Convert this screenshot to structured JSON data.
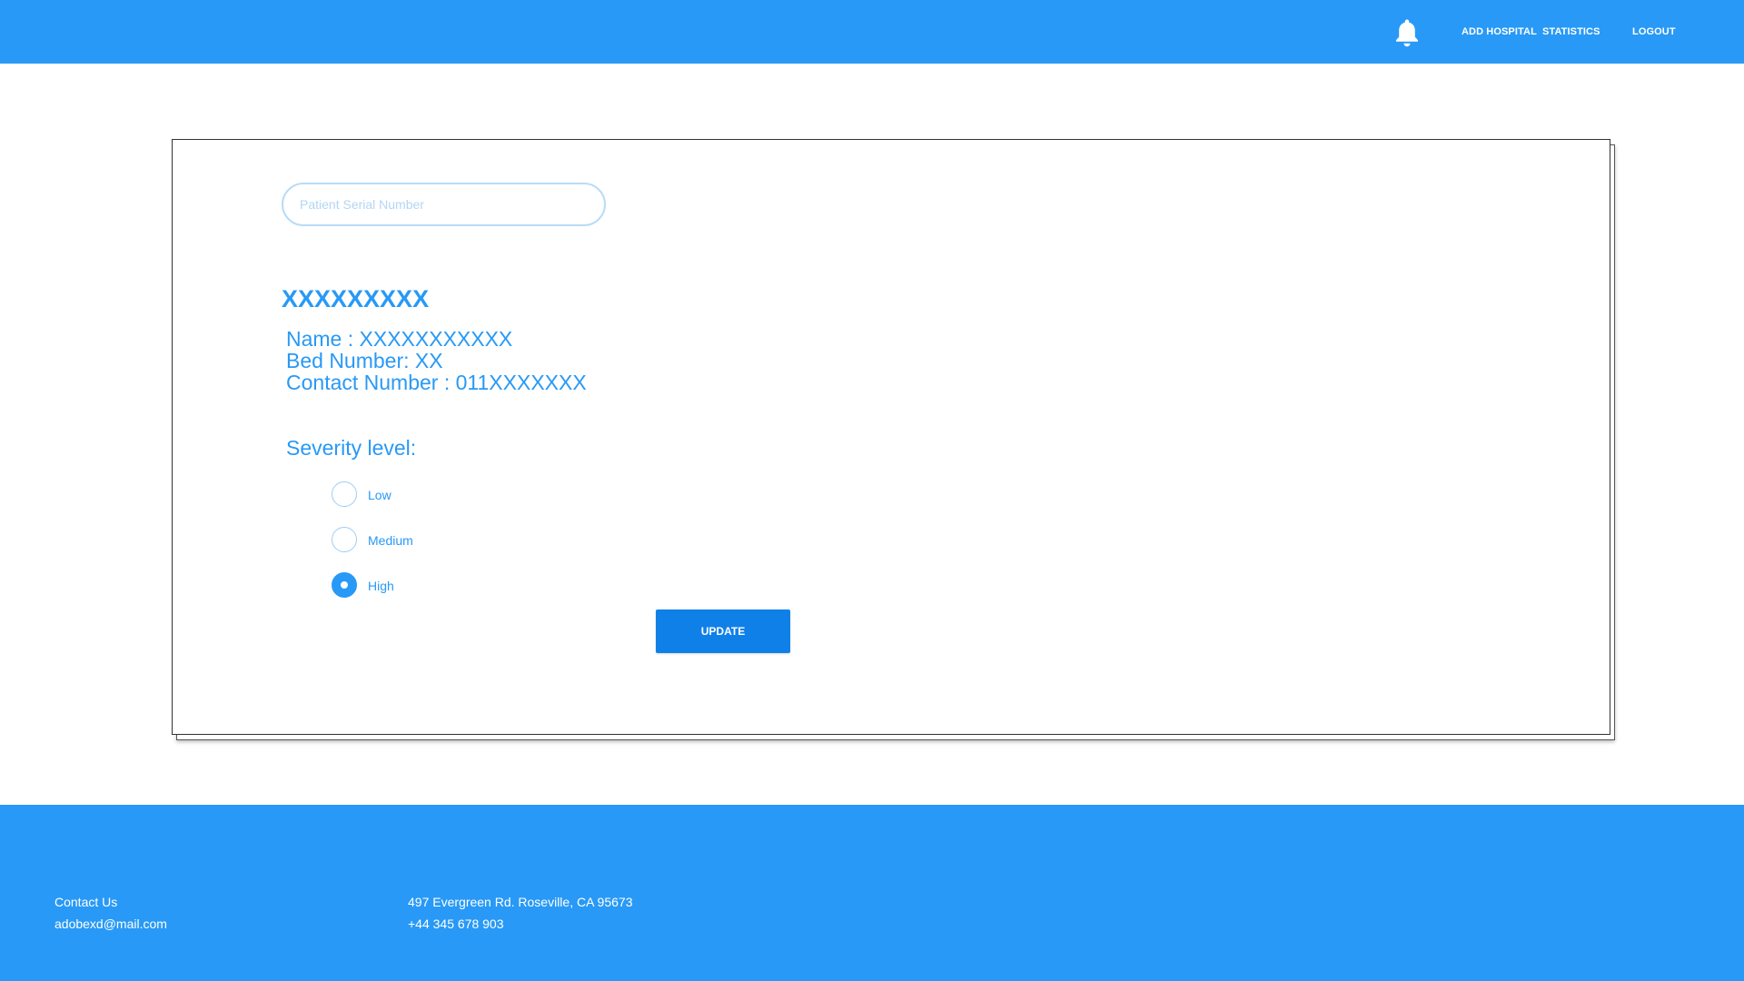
{
  "header": {
    "nav": {
      "add_hospital": "ADD HOSPITAL",
      "statistics": "STATISTICS",
      "logout": "LOGOUT"
    },
    "notification_icon": "bell-icon"
  },
  "search": {
    "placeholder": "Patient Serial Number",
    "value": ""
  },
  "patient": {
    "id": "XXXXXXXXX",
    "name_line": "Name : XXXXXXXXXXX",
    "bed_line": "Bed Number: XX",
    "contact_line": "Contact Number : 011XXXXXXX"
  },
  "severity": {
    "label": "Severity level:",
    "options": [
      {
        "label": "Low",
        "checked": false
      },
      {
        "label": "Medium",
        "checked": false
      },
      {
        "label": "High",
        "checked": true
      }
    ],
    "selected": "High"
  },
  "update_button": {
    "label": "UPDATE"
  },
  "footer": {
    "contact_label": "Contact Us",
    "email": "adobexd@mail.com",
    "address": "497 Evergreen Rd. Roseville, CA 95673",
    "phone": "+44 345 678 903"
  },
  "colors": {
    "primary": "#2899f6",
    "button": "#0f80e8"
  }
}
